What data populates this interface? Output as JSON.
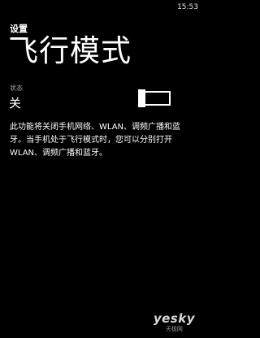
{
  "status_bar": {
    "time": "15:53"
  },
  "header": {
    "app_title": "设置",
    "page_title": "飞行模式"
  },
  "airplane_mode": {
    "state_label": "状态",
    "state_value": "关",
    "toggle_on": false
  },
  "description": "此功能将关闭手机网络、WLAN、调频广播和蓝牙。当手机处于飞行模式时，您可以分别打开 WLAN、调频广播和蓝牙。",
  "watermark": {
    "logo": "yesky",
    "sub": "天极网"
  },
  "colors": {
    "background": "#000000",
    "text": "#ffffff",
    "secondary_text": "#a9a9a9"
  }
}
